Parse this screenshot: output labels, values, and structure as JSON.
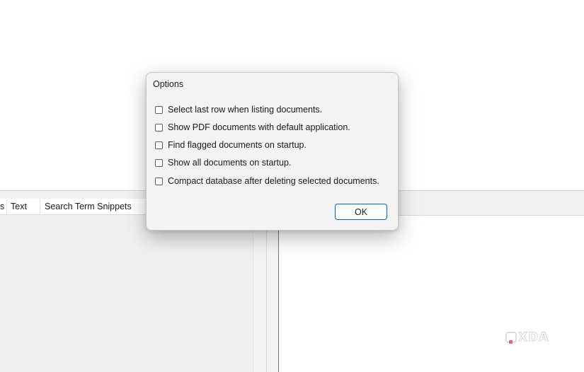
{
  "list": {
    "columns": [
      "s",
      "Text",
      "Search Term Snippets"
    ]
  },
  "dialog": {
    "title": "Options",
    "options": [
      {
        "label": "Select last row when listing documents.",
        "checked": false
      },
      {
        "label": "Show PDF documents with default application.",
        "checked": false
      },
      {
        "label": "Find flagged documents on startup.",
        "checked": false
      },
      {
        "label": "Show all documents on startup.",
        "checked": false
      },
      {
        "label": "Compact database after deleting selected documents.",
        "checked": false
      }
    ],
    "ok_label": "OK"
  },
  "watermark": {
    "text": "XDA",
    "accent": "#e04a6a"
  },
  "colors": {
    "button_border": "#0a64c2",
    "dialog_bg": "#f3f3f3"
  }
}
